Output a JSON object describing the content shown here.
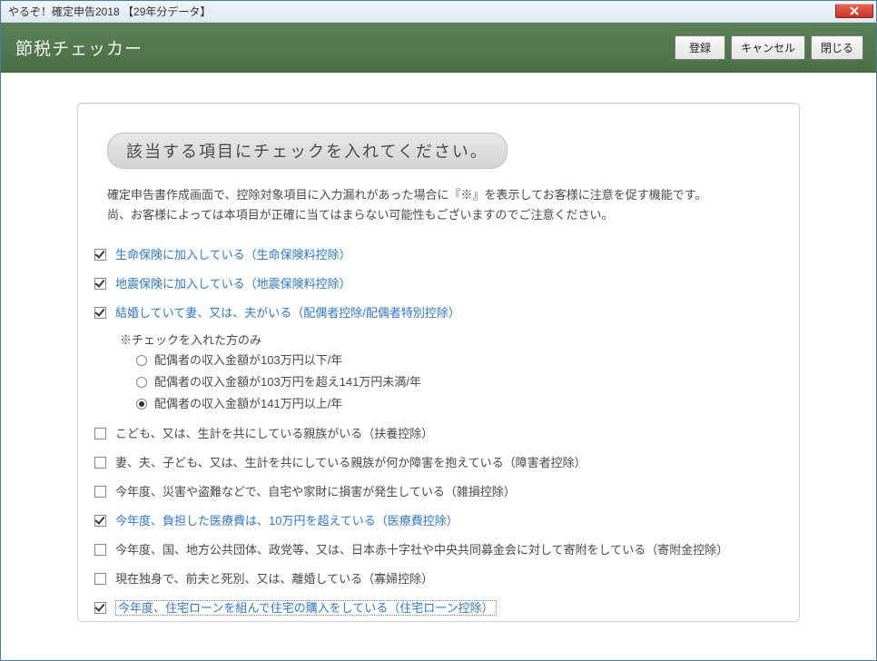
{
  "window": {
    "title": "やるぞ！確定申告2018 【29年分データ】"
  },
  "header": {
    "title": "節税チェッカー",
    "buttons": {
      "register": "登録",
      "cancel": "キャンセル",
      "close": "閉じる"
    }
  },
  "panel": {
    "instruction": "該当する項目にチェックを入れてください。",
    "description_line1": "確定申告書作成画面で、控除対象項目に入力漏れがあった場合に『※』を表示してお客様に注意を促す機能です。",
    "description_line2": "尚、お客様によっては本項目が正確に当てはまらない可能性もございますのでご注意ください。",
    "items": [
      {
        "label": "生命保険に加入している（生命保険料控除）",
        "checked": true,
        "enabled_link": true
      },
      {
        "label": "地震保険に加入している（地震保険料控除）",
        "checked": true,
        "enabled_link": true
      },
      {
        "label": "結婚していて妻、又は、夫がいる（配偶者控除/配偶者特別控除）",
        "checked": true,
        "enabled_link": true
      },
      {
        "label": "こども、又は、生計を共にしている親族がいる（扶養控除）",
        "checked": false,
        "enabled_link": false
      },
      {
        "label": "妻、夫、子ども、又は、生計を共にしている親族が何か障害を抱えている（障害者控除）",
        "checked": false,
        "enabled_link": false
      },
      {
        "label": "今年度、災害や盗難などで、自宅や家財に損害が発生している（雑損控除）",
        "checked": false,
        "enabled_link": false
      },
      {
        "label": "今年度、負担した医療費は、10万円を超えている（医療費控除）",
        "checked": true,
        "enabled_link": true
      },
      {
        "label": "今年度、国、地方公共団体、政党等、又は、日本赤十字社や中央共同募金会に対して寄附をしている（寄附金控除）",
        "checked": false,
        "enabled_link": false
      },
      {
        "label": "現在独身で、前夫と死別、又は、離婚している（寡婦控除）",
        "checked": false,
        "enabled_link": false
      },
      {
        "label": "今年度、住宅ローンを組んで住宅の購入をしている（住宅ローン控除）",
        "checked": true,
        "enabled_link": true,
        "selected_visual": true
      }
    ],
    "sub": {
      "note": "※チェックを入れた方のみ",
      "radios": [
        {
          "label": "配偶者の収入金額が103万円以下/年",
          "selected": false,
          "enabled_link": false
        },
        {
          "label": "配偶者の収入金額が103万円を超え141万円未満/年",
          "selected": false,
          "enabled_link": false
        },
        {
          "label": "配偶者の収入金額が141万円以上/年",
          "selected": true,
          "enabled_link": true
        }
      ]
    }
  }
}
